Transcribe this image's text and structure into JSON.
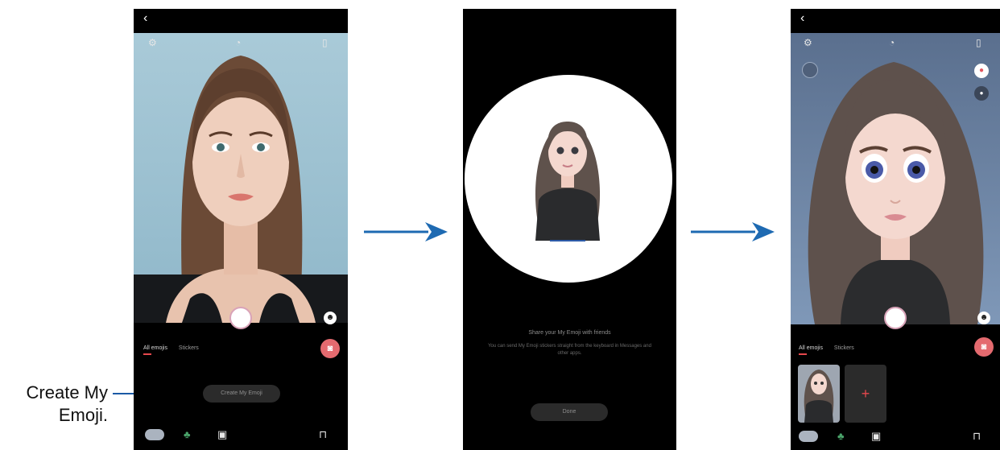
{
  "callout": {
    "line1": "Create My",
    "line2": "Emoji."
  },
  "screen1": {
    "tabs": [
      "All emojis",
      "Stickers"
    ],
    "create_button": "Create My Emoji"
  },
  "screen2": {
    "share_title": "Share your My Emoji with friends",
    "share_body": "You can send My Emoji stickers straight from the keyboard in Messages and other apps.",
    "done_button": "Done"
  },
  "screen3": {
    "tabs": [
      "All emojis",
      "Stickers"
    ],
    "add_glyph": "+"
  },
  "icons": {
    "back": "‹",
    "settings": "⚙",
    "timer": "◔",
    "ratio": "▯",
    "shop": "⊓"
  }
}
